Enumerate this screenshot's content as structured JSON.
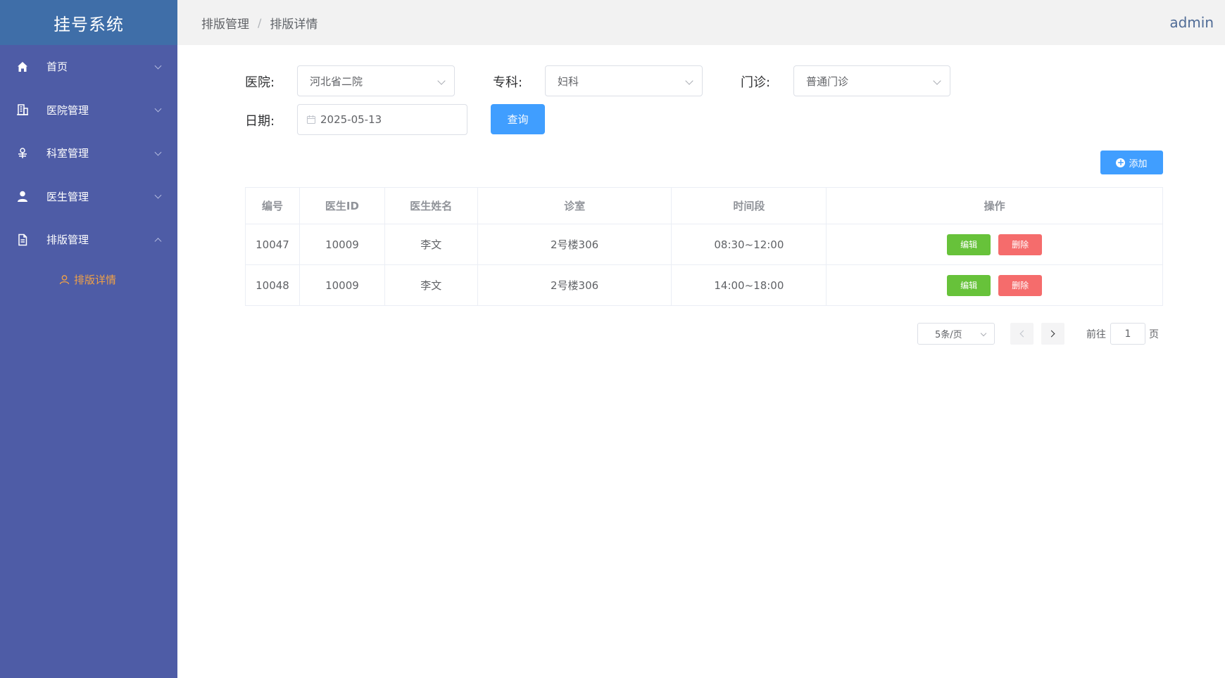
{
  "app": {
    "title": "挂号系统",
    "user": "admin"
  },
  "sidebar": {
    "items": [
      {
        "label": "首页",
        "icon": "home-icon"
      },
      {
        "label": "医院管理",
        "icon": "building-icon"
      },
      {
        "label": "科室管理",
        "icon": "department-icon"
      },
      {
        "label": "医生管理",
        "icon": "user-icon"
      },
      {
        "label": "排版管理",
        "icon": "document-icon",
        "expanded": true
      }
    ],
    "sub_items": [
      {
        "label": "排版详情",
        "icon": "person-outline-icon",
        "active": true
      }
    ]
  },
  "breadcrumb": {
    "parent": "排版管理",
    "separator": "/",
    "current": "排版详情"
  },
  "filters": {
    "hospital": {
      "label": "医院:",
      "value": "河北省二院"
    },
    "specialty": {
      "label": "专科:",
      "value": "妇科"
    },
    "clinic": {
      "label": "门诊:",
      "value": "普通门诊"
    },
    "date": {
      "label": "日期:",
      "value": "2025-05-13"
    },
    "query_label": "查询"
  },
  "toolbar": {
    "add_label": "添加"
  },
  "table": {
    "columns": [
      "编号",
      "医生ID",
      "医生姓名",
      "诊室",
      "时间段",
      "操作"
    ],
    "rows": [
      {
        "id": "10047",
        "doctor_id": "10009",
        "doctor_name": "李文",
        "room": "2号楼306",
        "time": "08:30~12:00"
      },
      {
        "id": "10048",
        "doctor_id": "10009",
        "doctor_name": "李文",
        "room": "2号楼306",
        "time": "14:00~18:00"
      }
    ],
    "edit_label": "编辑",
    "delete_label": "删除"
  },
  "pagination": {
    "page_size": "5条/页",
    "goto_prefix": "前往",
    "page": "1",
    "goto_suffix": "页"
  },
  "colors": {
    "sidebar": "#4e5ca6",
    "logo_bg": "#3f6ea8",
    "primary": "#409eff",
    "success": "#67c23a",
    "danger": "#f56c6c",
    "active_sub": "#f0a146"
  }
}
